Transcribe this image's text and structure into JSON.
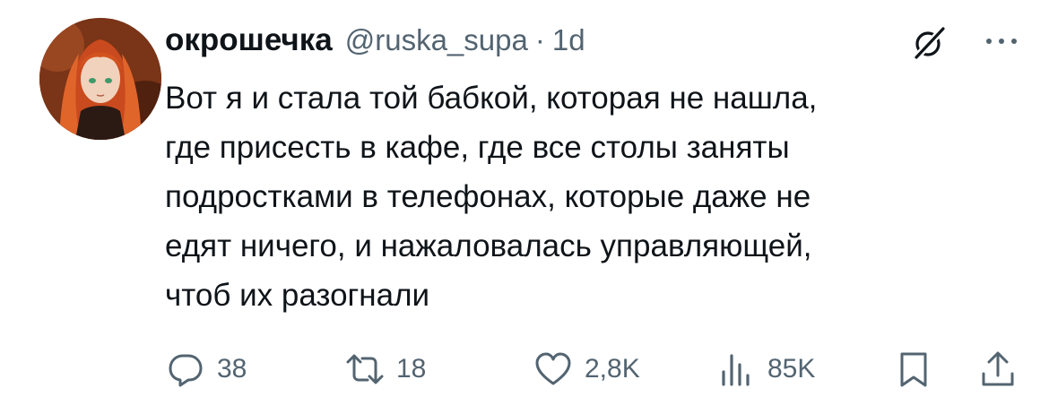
{
  "tweet": {
    "author_name": "окрошечка",
    "handle": "@ruska_supa",
    "separator": "·",
    "time": "1d",
    "text": "Вот я и стала той бабкой, которая не нашла,\nгде присесть в кафе, где все столы заняты\nподростками в телефонах, которые даже не\nедят ничего, и нажаловалась управляющей,\nчтоб их разогнали"
  },
  "actions": {
    "replies": "38",
    "reposts": "18",
    "likes": "2,8K",
    "views": "85K"
  },
  "icons": {
    "grok": "grok-icon",
    "more": "more-icon",
    "reply": "reply-icon",
    "repost": "repost-icon",
    "like": "heart-icon",
    "views": "views-icon",
    "bookmark": "bookmark-icon",
    "share": "share-icon"
  },
  "colors": {
    "text": "#0f1419",
    "secondary": "#536471",
    "background": "#ffffff"
  }
}
